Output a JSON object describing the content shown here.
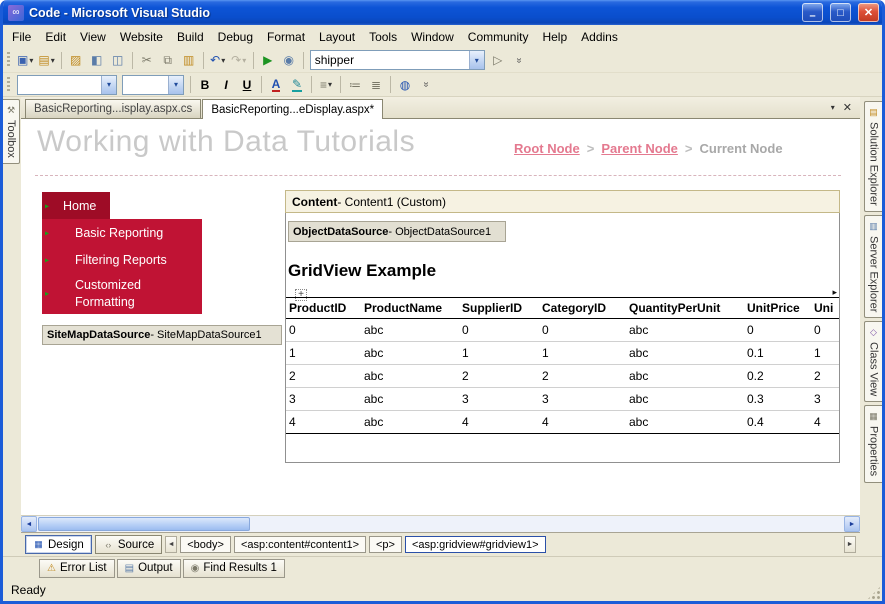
{
  "colors": {
    "chrome_bg": "#ECE9D8",
    "titlebar_blue": "#0A50D2",
    "nav_home_bg": "#9E0C26",
    "nav_item_bg": "#C01334",
    "link_pink": "#E4798F",
    "muted_heading": "#C9C9C9",
    "content_bar_bg": "#F6F2E2",
    "selection_blue": "#2B50A8"
  },
  "titlebar": {
    "title": "Code - Microsoft Visual Studio"
  },
  "menu": {
    "items": [
      "File",
      "Edit",
      "View",
      "Website",
      "Build",
      "Debug",
      "Format",
      "Layout",
      "Tools",
      "Window",
      "Community",
      "Help",
      "Addins"
    ]
  },
  "toolbars": {
    "standard": {
      "combo_value": "shipper"
    },
    "formatting": {
      "font_name": "",
      "font_size": "",
      "bold": "B",
      "italic": "I",
      "underline": "U",
      "font_color": "A"
    }
  },
  "icons": {
    "vs_logo": "∞",
    "minimize": "–",
    "maximize": "□",
    "close": "✕",
    "new_project": "▣",
    "add_item": "▤",
    "open_file": "▨",
    "save": "◧",
    "save_all": "◫",
    "cut": "✂",
    "copy": "⧉",
    "paste": "▥",
    "undo": "↶",
    "redo": "↷",
    "start_debug": "▶",
    "find_in_files": "◉",
    "data_preview": "▷",
    "dropdown": "▾",
    "overflow": "»",
    "highlight": "✎",
    "align": "≡",
    "bullet_list": "≔",
    "numbered_list": "≣",
    "hyperlink": "◍",
    "toolbox": "⚒",
    "solution_explorer": "▤",
    "server_explorer": "▥",
    "class_view": "◇",
    "properties": "▦",
    "tab_list": "▾",
    "tab_close": "✕",
    "scroll_left": "◄",
    "scroll_right": "►",
    "move_handle": "+",
    "smart_tag": "▸",
    "error_list": "⚠",
    "output": "▤",
    "find_results": "◉",
    "design_view": "▦",
    "source_view": "‹›"
  },
  "doc_tabs": {
    "tab1": "BasicReporting...isplay.aspx.cs",
    "tab2": "BasicReporting...eDisplay.aspx*"
  },
  "left_panel": {
    "toolbox_label": "Toolbox"
  },
  "right_panel": {
    "tabs": [
      "Solution Explorer",
      "Server Explorer",
      "Class View",
      "Properties"
    ]
  },
  "design": {
    "page_heading": "Working with Data Tutorials",
    "breadcrumb": {
      "root": "Root Node",
      "sep": ">",
      "parent": "Parent Node",
      "current": "Current Node"
    },
    "nav": {
      "items": [
        "Home",
        "Basic Reporting",
        "Filtering Reports",
        "Customized Formatting"
      ]
    },
    "sitemap_datasource": {
      "name": "SiteMapDataSource",
      "suffix": " - SiteMapDataSource1"
    },
    "content_header": {
      "name": "Content",
      "suffix": " - Content1 (Custom)"
    },
    "object_datasource": {
      "name": "ObjectDataSource",
      "suffix": " - ObjectDataSource1"
    },
    "gridview_heading": "GridView Example",
    "gridview": {
      "columns": [
        "ProductID",
        "ProductName",
        "SupplierID",
        "CategoryID",
        "QuantityPerUnit",
        "UnitPrice",
        "Uni"
      ],
      "rows": [
        [
          "0",
          "abc",
          "0",
          "0",
          "abc",
          "0",
          "0"
        ],
        [
          "1",
          "abc",
          "1",
          "1",
          "abc",
          "0.1",
          "1"
        ],
        [
          "2",
          "abc",
          "2",
          "2",
          "abc",
          "0.2",
          "2"
        ],
        [
          "3",
          "abc",
          "3",
          "3",
          "abc",
          "0.3",
          "3"
        ],
        [
          "4",
          "abc",
          "4",
          "4",
          "abc",
          "0.4",
          "4"
        ]
      ]
    }
  },
  "viewbar": {
    "design_label": "Design",
    "source_label": "Source",
    "tags": [
      "<body>",
      "<asp:content#content1>",
      "<p>",
      "<asp:gridview#gridview1>"
    ]
  },
  "bottom_tabs": {
    "error_list": "Error List",
    "output": "Output",
    "find_results": "Find Results 1"
  },
  "statusbar": {
    "text": "Ready"
  }
}
